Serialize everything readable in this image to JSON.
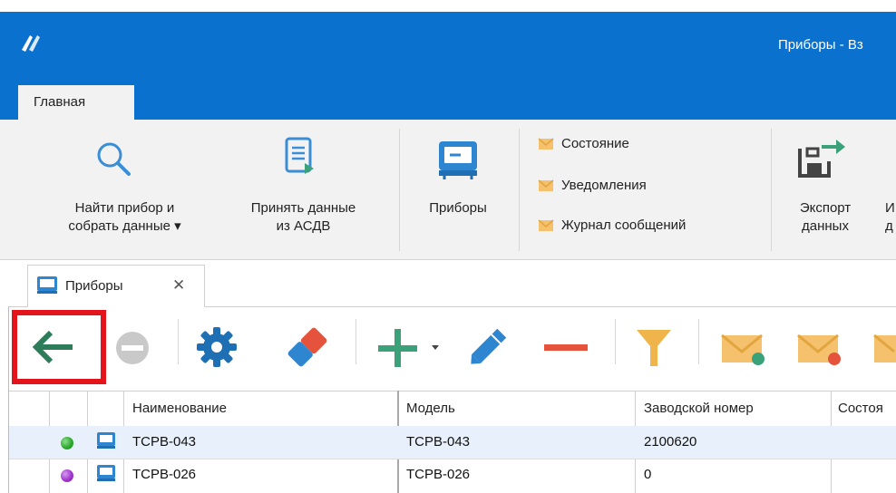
{
  "window": {
    "title": "Приборы - Вз"
  },
  "ribbon": {
    "tab_home": "Главная",
    "find_device": {
      "line1": "Найти прибор и",
      "line2": "собрать данные ▾"
    },
    "accept_data": {
      "line1": "Принять данные",
      "line2": "из АСДВ"
    },
    "devices": "Приборы",
    "small_items": [
      "Состояние",
      "Уведомления",
      "Журнал сообщений"
    ],
    "export": {
      "line1": "Экспорт",
      "line2": "данных"
    },
    "cut_label": {
      "line1": "И",
      "line2": "д"
    }
  },
  "doc_tab": {
    "label": "Приборы",
    "close": "✕"
  },
  "toolbar": {
    "icons": [
      "back-arrow-icon",
      "stop-icon",
      "settings-gear-icon",
      "eraser-icon",
      "add-icon",
      "dropdown-arrow-icon",
      "edit-pencil-icon",
      "remove-minus-icon",
      "filter-icon",
      "mail-green-icon",
      "mail-red-icon",
      "mail-partial-icon"
    ],
    "accent": "#2e7d5a"
  },
  "grid": {
    "headers": [
      "Наименование",
      "Модель",
      "Заводской номер",
      "Состоя"
    ],
    "rows": [
      {
        "status_color": "#29a329",
        "name": "ТСРВ-043",
        "model": "ТСРВ-043",
        "serial": "2100620"
      },
      {
        "status_color": "#9b30c8",
        "name": "ТСРВ-026",
        "model": "ТСРВ-026",
        "serial": "0"
      }
    ]
  }
}
